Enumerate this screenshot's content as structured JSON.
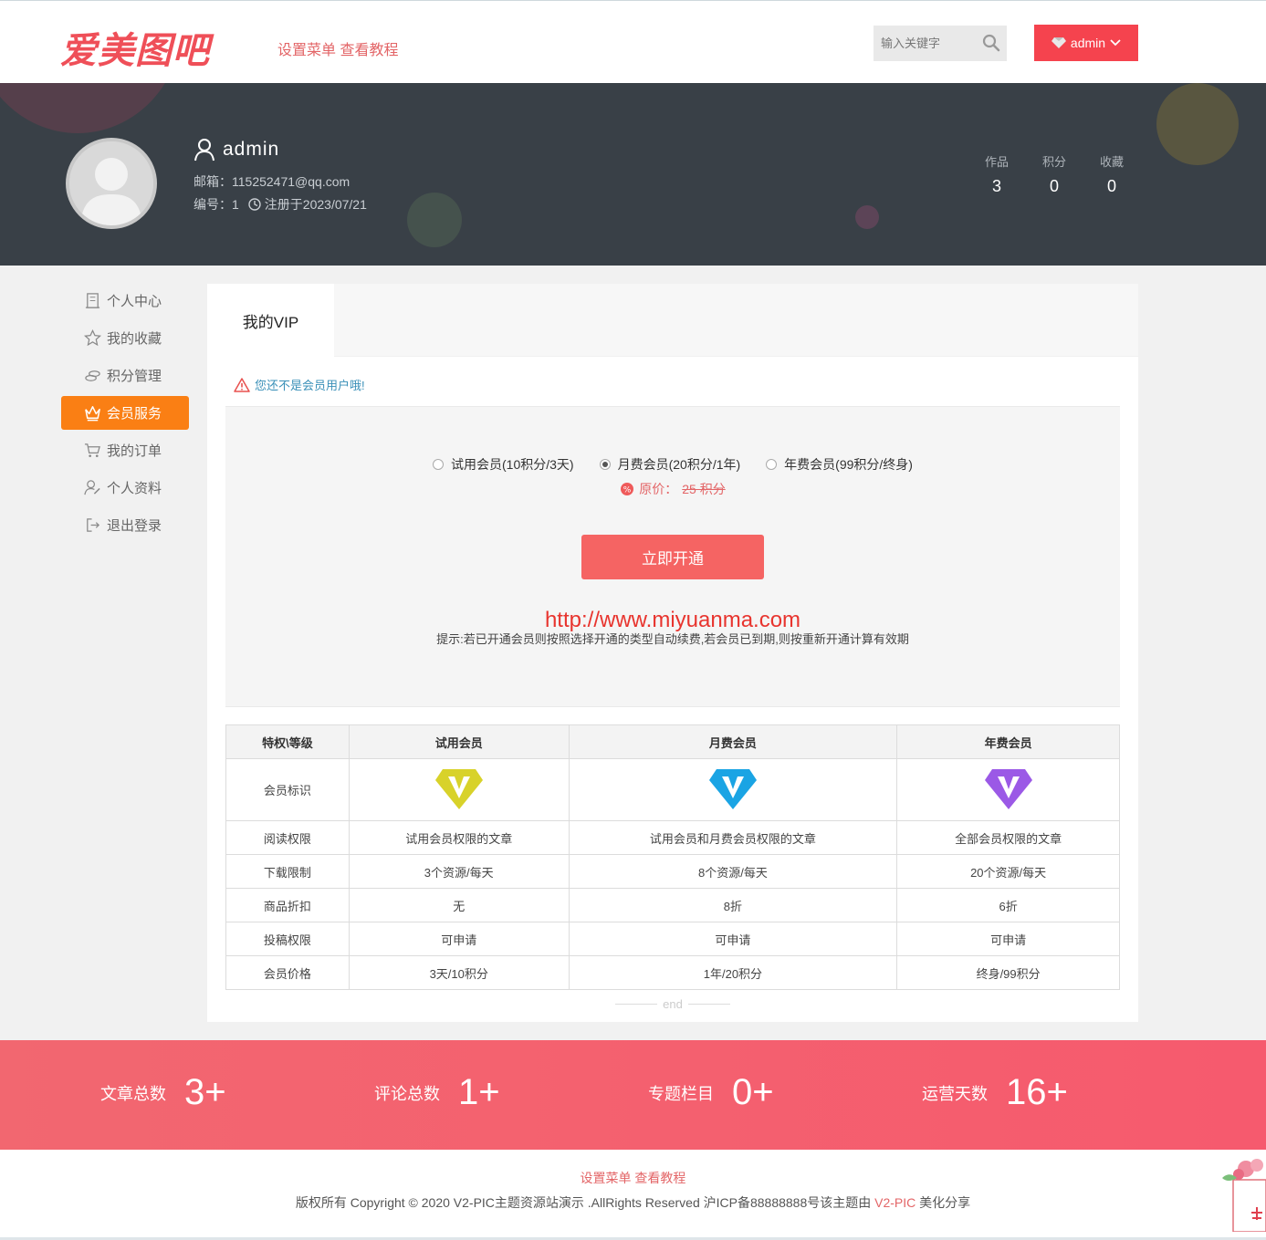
{
  "header": {
    "logo_text": "爱美图吧",
    "links_text": "设置菜单 查看教程",
    "search_placeholder": "输入关键字",
    "user_label": "admin"
  },
  "profile": {
    "username": "admin",
    "email_line": "邮箱：115252471@qq.com",
    "id_line": "编号：1",
    "register_line": "注册于2023/07/21",
    "stats": [
      {
        "label": "作品",
        "value": "3"
      },
      {
        "label": "积分",
        "value": "0"
      },
      {
        "label": "收藏",
        "value": "0"
      }
    ]
  },
  "sidebar": {
    "items": [
      {
        "label": "个人中心",
        "icon": "building-icon"
      },
      {
        "label": "我的收藏",
        "icon": "star-icon"
      },
      {
        "label": "积分管理",
        "icon": "coins-icon"
      },
      {
        "label": "会员服务",
        "icon": "crown-icon"
      },
      {
        "label": "我的订单",
        "icon": "cart-icon"
      },
      {
        "label": "个人资料",
        "icon": "user-edit-icon"
      },
      {
        "label": "退出登录",
        "icon": "logout-icon"
      }
    ],
    "active": "会员服务"
  },
  "main": {
    "tab_label": "我的VIP",
    "notice": "您还不是会员用户哦!",
    "options": [
      {
        "label": "试用会员(10积分/3天)",
        "selected": false
      },
      {
        "label": "月费会员(20积分/1年)",
        "selected": true
      },
      {
        "label": "年费会员(99积分/终身)",
        "selected": false
      }
    ],
    "orig_label": "原价：",
    "orig_price": "25 积分",
    "open_button": "立即开通",
    "watermark": "http://www.miyuanma.com",
    "tip": "提示:若已开通会员则按照选择开通的类型自动续费,若会员已到期,则按重新开通计算有效期",
    "table": {
      "headers": [
        "特权\\等级",
        "试用会员",
        "月费会员",
        "年费会员"
      ],
      "icon_row_label": "会员标识",
      "icon_colors": [
        "#d8d22a",
        "#1aa4e4",
        "#9b59e6"
      ],
      "rows": [
        [
          "阅读权限",
          "试用会员权限的文章",
          "试用会员和月费会员权限的文章",
          "全部会员权限的文章"
        ],
        [
          "下载限制",
          "3个资源/每天",
          "8个资源/每天",
          "20个资源/每天"
        ],
        [
          "商品折扣",
          "无",
          "8折",
          "6折"
        ],
        [
          "投稿权限",
          "可申请",
          "可申请",
          "可申请"
        ],
        [
          "会员价格",
          "3天/10积分",
          "1年/20积分",
          "终身/99积分"
        ]
      ]
    },
    "end_text": "end"
  },
  "band": {
    "stats": [
      {
        "label": "文章总数",
        "value": "3+"
      },
      {
        "label": "评论总数",
        "value": "1+"
      },
      {
        "label": "专题栏目",
        "value": "0+"
      },
      {
        "label": "运营天数",
        "value": "16+"
      }
    ]
  },
  "footer": {
    "links_text": "设置菜单 查看教程",
    "copyright": "版权所有 Copyright © 2020 V2-PIC主题资源站演示 .AllRights Reserved 沪ICP备88888888号该主题由 ",
    "brand": "V2-PIC",
    "suffix": " 美化分享"
  },
  "colors": {
    "accent": "#f5434e",
    "active_sidebar": "#fa7f14",
    "banner_bg": "#394047",
    "band": "#f26770"
  }
}
